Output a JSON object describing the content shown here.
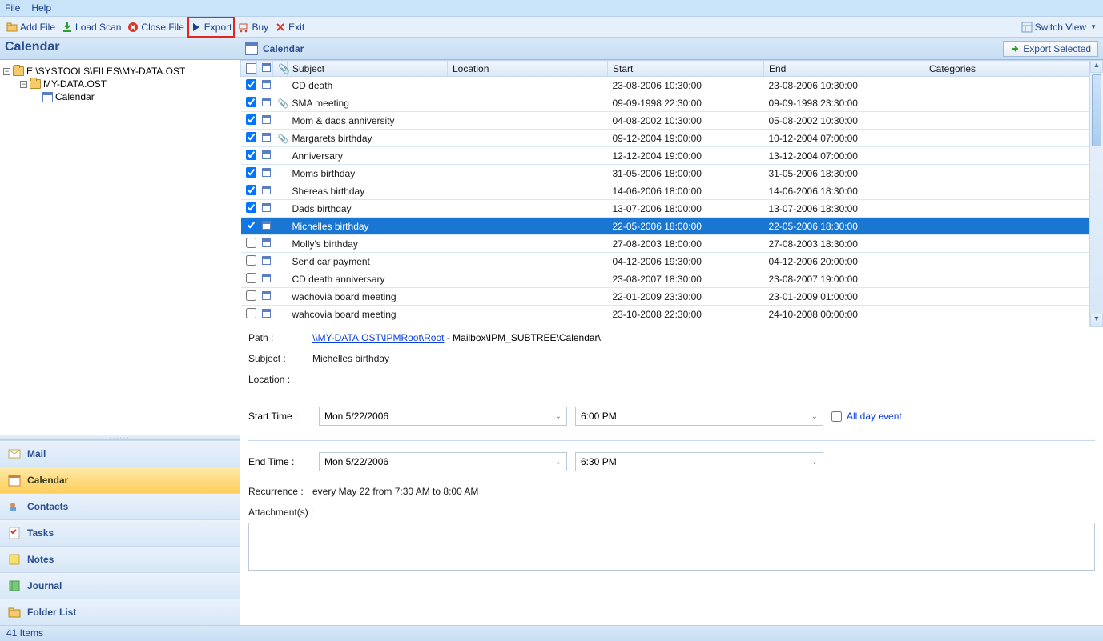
{
  "menu": {
    "file": "File",
    "help": "Help"
  },
  "toolbar": {
    "add_file": "Add File",
    "load_scan": "Load Scan",
    "close_file": "Close File",
    "export": "Export",
    "buy": "Buy",
    "exit": "Exit",
    "switch_view": "Switch View"
  },
  "left": {
    "title": "Calendar",
    "tree": {
      "root": "E:\\SYSTOOLS\\FILES\\MY-DATA.OST",
      "node": "MY-DATA.OST",
      "leaf": "Calendar"
    },
    "nav": {
      "mail": "Mail",
      "calendar": "Calendar",
      "contacts": "Contacts",
      "tasks": "Tasks",
      "notes": "Notes",
      "journal": "Journal",
      "folder_list": "Folder List"
    }
  },
  "right": {
    "title": "Calendar",
    "export_selected": "Export Selected"
  },
  "columns": {
    "subject": "Subject",
    "location": "Location",
    "start": "Start",
    "end": "End",
    "categories": "Categories"
  },
  "rows": [
    {
      "chk": true,
      "att": false,
      "subject": "CD death",
      "loc": "",
      "start": "23-08-2006 10:30:00",
      "end": "23-08-2006 10:30:00",
      "cat": "",
      "sel": false
    },
    {
      "chk": true,
      "att": true,
      "subject": "SMA meeting",
      "loc": "",
      "start": "09-09-1998 22:30:00",
      "end": "09-09-1998 23:30:00",
      "cat": "",
      "sel": false
    },
    {
      "chk": true,
      "att": false,
      "subject": "Mom & dads anniversity",
      "loc": "",
      "start": "04-08-2002 10:30:00",
      "end": "05-08-2002 10:30:00",
      "cat": "",
      "sel": false
    },
    {
      "chk": true,
      "att": true,
      "subject": "Margarets birthday",
      "loc": "",
      "start": "09-12-2004 19:00:00",
      "end": "10-12-2004 07:00:00",
      "cat": "",
      "sel": false
    },
    {
      "chk": true,
      "att": false,
      "subject": "Anniversary",
      "loc": "",
      "start": "12-12-2004 19:00:00",
      "end": "13-12-2004 07:00:00",
      "cat": "",
      "sel": false
    },
    {
      "chk": true,
      "att": false,
      "subject": "Moms birthday",
      "loc": "",
      "start": "31-05-2006 18:00:00",
      "end": "31-05-2006 18:30:00",
      "cat": "",
      "sel": false
    },
    {
      "chk": true,
      "att": false,
      "subject": "Shereas birthday",
      "loc": "",
      "start": "14-06-2006 18:00:00",
      "end": "14-06-2006 18:30:00",
      "cat": "",
      "sel": false
    },
    {
      "chk": true,
      "att": false,
      "subject": "Dads birthday",
      "loc": "",
      "start": "13-07-2006 18:00:00",
      "end": "13-07-2006 18:30:00",
      "cat": "",
      "sel": false
    },
    {
      "chk": true,
      "att": false,
      "subject": "Michelles birthday",
      "loc": "",
      "start": "22-05-2006 18:00:00",
      "end": "22-05-2006 18:30:00",
      "cat": "",
      "sel": true
    },
    {
      "chk": false,
      "att": false,
      "subject": "Molly's birthday",
      "loc": "",
      "start": "27-08-2003 18:00:00",
      "end": "27-08-2003 18:30:00",
      "cat": "",
      "sel": false
    },
    {
      "chk": false,
      "att": false,
      "subject": "Send car payment",
      "loc": "",
      "start": "04-12-2006 19:30:00",
      "end": "04-12-2006 20:00:00",
      "cat": "",
      "sel": false
    },
    {
      "chk": false,
      "att": false,
      "subject": "CD death anniversary",
      "loc": "",
      "start": "23-08-2007 18:30:00",
      "end": "23-08-2007 19:00:00",
      "cat": "",
      "sel": false
    },
    {
      "chk": false,
      "att": false,
      "subject": "wachovia board meeting",
      "loc": "",
      "start": "22-01-2009 23:30:00",
      "end": "23-01-2009 01:00:00",
      "cat": "",
      "sel": false
    },
    {
      "chk": false,
      "att": false,
      "subject": "wahcovia board meeting",
      "loc": "",
      "start": "23-10-2008 22:30:00",
      "end": "24-10-2008 00:00:00",
      "cat": "",
      "sel": false
    }
  ],
  "details": {
    "path_label": "Path :",
    "path_link": "\\\\MY-DATA.OST\\IPMRoot\\Root",
    "path_tail": " - Mailbox\\IPM_SUBTREE\\Calendar\\",
    "subject_label": "Subject :",
    "subject": "Michelles birthday",
    "location_label": "Location :",
    "location": "",
    "start_label": "Start Time :",
    "start_date": "Mon 5/22/2006",
    "start_time": "6:00 PM",
    "all_day": "All day event",
    "end_label": "End Time :",
    "end_date": "Mon 5/22/2006",
    "end_time": "6:30 PM",
    "recur_label": "Recurrence :",
    "recur": "every May 22 from 7:30 AM to 8:00 AM",
    "att_label": "Attachment(s) :"
  },
  "status": {
    "items": "41 Items"
  }
}
